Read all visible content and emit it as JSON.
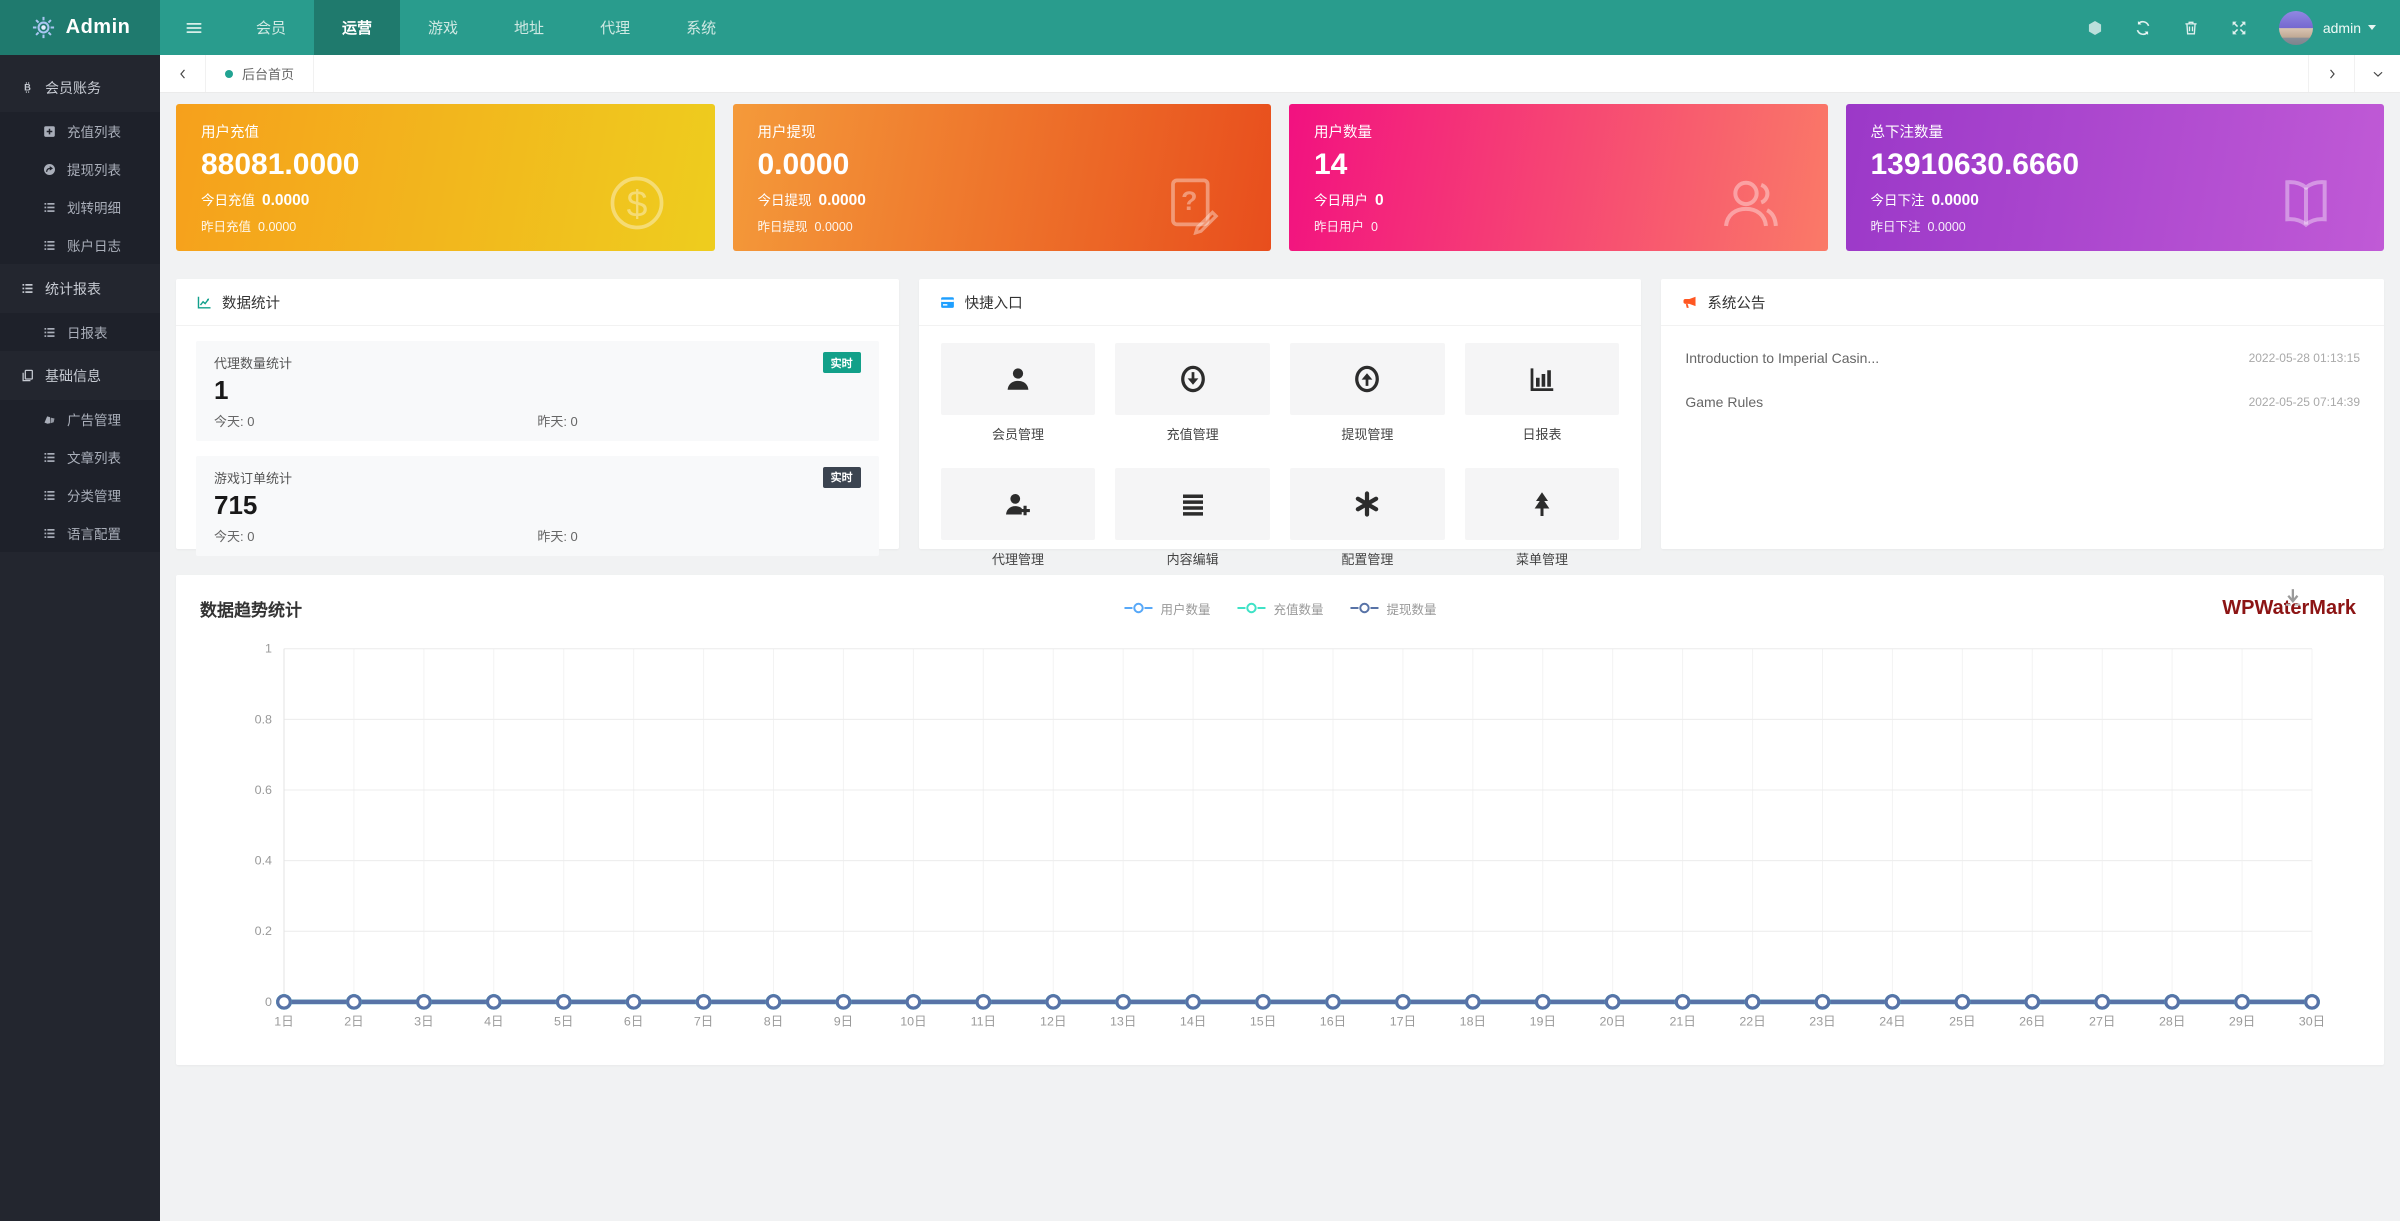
{
  "navbar": {
    "brand": "Admin",
    "menu": [
      {
        "label": "会员",
        "active": false
      },
      {
        "label": "运营",
        "active": true
      },
      {
        "label": "游戏",
        "active": false
      },
      {
        "label": "地址",
        "active": false
      },
      {
        "label": "代理",
        "active": false
      },
      {
        "label": "系统",
        "active": false
      }
    ],
    "actions": [
      {
        "icon": "theme-icon"
      },
      {
        "icon": "refresh-icon"
      },
      {
        "icon": "trash-icon"
      },
      {
        "icon": "fullscreen-icon"
      }
    ],
    "user": "admin",
    "colors": {
      "bar": "#299c8d",
      "active": "#1f7a6d"
    }
  },
  "tabbar": {
    "active_tab": "后台首页",
    "dot_color": "#21a392"
  },
  "sidebar": {
    "items": [
      {
        "label": "会员账务",
        "icon": "bitcoin-icon",
        "type": "parent"
      },
      {
        "label": "充值列表",
        "icon": "plus-square-icon",
        "type": "child"
      },
      {
        "label": "提现列表",
        "icon": "withdraw-icon",
        "type": "child"
      },
      {
        "label": "划转明细",
        "icon": "list-icon",
        "type": "child"
      },
      {
        "label": "账户日志",
        "icon": "list-icon",
        "type": "child"
      },
      {
        "label": "统计报表",
        "icon": "list-icon",
        "type": "parent"
      },
      {
        "label": "日报表",
        "icon": "list-icon",
        "type": "child"
      },
      {
        "label": "基础信息",
        "icon": "copy-icon",
        "type": "parent"
      },
      {
        "label": "广告管理",
        "icon": "ad-icon",
        "type": "child"
      },
      {
        "label": "文章列表",
        "icon": "list-icon",
        "type": "child"
      },
      {
        "label": "分类管理",
        "icon": "list-icon",
        "type": "child"
      },
      {
        "label": "语言配置",
        "icon": "list-icon",
        "type": "child"
      }
    ]
  },
  "stat_cards": [
    {
      "label": "用户充值",
      "value": "88081.0000",
      "today_label": "今日充值",
      "today_value": "0.0000",
      "yesterday_label": "昨日充值",
      "yesterday_value": "0.0000",
      "icon": "dollar-circle-icon",
      "gradient": [
        "#f6a01c",
        "#eecd1e"
      ]
    },
    {
      "label": "用户提现",
      "value": "0.0000",
      "today_label": "今日提现",
      "today_value": "0.0000",
      "yesterday_label": "昨日提现",
      "yesterday_value": "0.0000",
      "icon": "file-question-icon",
      "gradient": [
        "#f49a3a",
        "#e84e1d"
      ]
    },
    {
      "label": "用户数量",
      "value": "14",
      "today_label": "今日用户",
      "today_value": "0",
      "yesterday_label": "昨日用户",
      "yesterday_value": "0",
      "icon": "users-icon",
      "gradient": [
        "#f21180",
        "#fa7a67"
      ]
    },
    {
      "label": "总下注数量",
      "value": "13910630.6660",
      "today_label": "今日下注",
      "today_value": "0.0000",
      "yesterday_label": "昨日下注",
      "yesterday_value": "0.0000",
      "icon": "book-icon",
      "gradient": [
        "#9b38c8",
        "#c05ad6"
      ]
    }
  ],
  "stats_panel": {
    "title": "数据统计",
    "header_icon": "line-chart-icon",
    "stats": [
      {
        "title": "代理数量统计",
        "badge": "实时",
        "badge_color": "#12a089",
        "value": "1",
        "today_label": "今天:",
        "today_value": "0",
        "yesterday_label": "昨天:",
        "yesterday_value": "0"
      },
      {
        "title": "游戏订单统计",
        "badge": "实时",
        "badge_color": "#3b4450",
        "value": "715",
        "today_label": "今天:",
        "today_value": "0",
        "yesterday_label": "昨天:",
        "yesterday_value": "0"
      }
    ]
  },
  "quick_panel": {
    "title": "快捷入口",
    "header_icon": "card-icon",
    "entries": [
      {
        "label": "会员管理",
        "icon": "user-icon"
      },
      {
        "label": "充值管理",
        "icon": "circle-down-icon"
      },
      {
        "label": "提现管理",
        "icon": "circle-up-icon"
      },
      {
        "label": "日报表",
        "icon": "bar-chart-icon"
      },
      {
        "label": "代理管理",
        "icon": "user-plus-icon"
      },
      {
        "label": "内容编辑",
        "icon": "bars-icon"
      },
      {
        "label": "配置管理",
        "icon": "asterisk-icon"
      },
      {
        "label": "菜单管理",
        "icon": "tree-icon"
      }
    ]
  },
  "announcement_panel": {
    "title": "系统公告",
    "header_icon": "bullhorn-icon",
    "items": [
      {
        "title": "Introduction to Imperial Casin...",
        "date": "2022-05-28 01:13:15"
      },
      {
        "title": "Game Rules",
        "date": "2022-05-25 07:14:39"
      }
    ]
  },
  "chart_panel": {
    "title": "数据趋势统计",
    "watermark": "WPWaterMark"
  },
  "chart_data": {
    "type": "line",
    "title": "数据趋势统计",
    "categories": [
      "1日",
      "2日",
      "3日",
      "4日",
      "5日",
      "6日",
      "7日",
      "8日",
      "9日",
      "10日",
      "11日",
      "12日",
      "13日",
      "14日",
      "15日",
      "16日",
      "17日",
      "18日",
      "19日",
      "20日",
      "21日",
      "22日",
      "23日",
      "24日",
      "25日",
      "26日",
      "27日",
      "28日",
      "29日",
      "30日"
    ],
    "series": [
      {
        "name": "用户数量",
        "color": "#57a8f8",
        "values": [
          0,
          0,
          0,
          0,
          0,
          0,
          0,
          0,
          0,
          0,
          0,
          0,
          0,
          0,
          0,
          0,
          0,
          0,
          0,
          0,
          0,
          0,
          0,
          0,
          0,
          0,
          0,
          0,
          0,
          0
        ]
      },
      {
        "name": "充值数量",
        "color": "#3fe2c6",
        "values": [
          0,
          0,
          0,
          0,
          0,
          0,
          0,
          0,
          0,
          0,
          0,
          0,
          0,
          0,
          0,
          0,
          0,
          0,
          0,
          0,
          0,
          0,
          0,
          0,
          0,
          0,
          0,
          0,
          0,
          0
        ]
      },
      {
        "name": "提现数量",
        "color": "#5873a7",
        "values": [
          0,
          0,
          0,
          0,
          0,
          0,
          0,
          0,
          0,
          0,
          0,
          0,
          0,
          0,
          0,
          0,
          0,
          0,
          0,
          0,
          0,
          0,
          0,
          0,
          0,
          0,
          0,
          0,
          0,
          0
        ]
      }
    ],
    "xlabel": "",
    "ylabel": "",
    "ylim": [
      0,
      1
    ],
    "yticks": [
      0,
      0.2,
      0.4,
      0.6,
      0.8,
      1
    ],
    "grid": true,
    "legend_position": "top-center"
  }
}
